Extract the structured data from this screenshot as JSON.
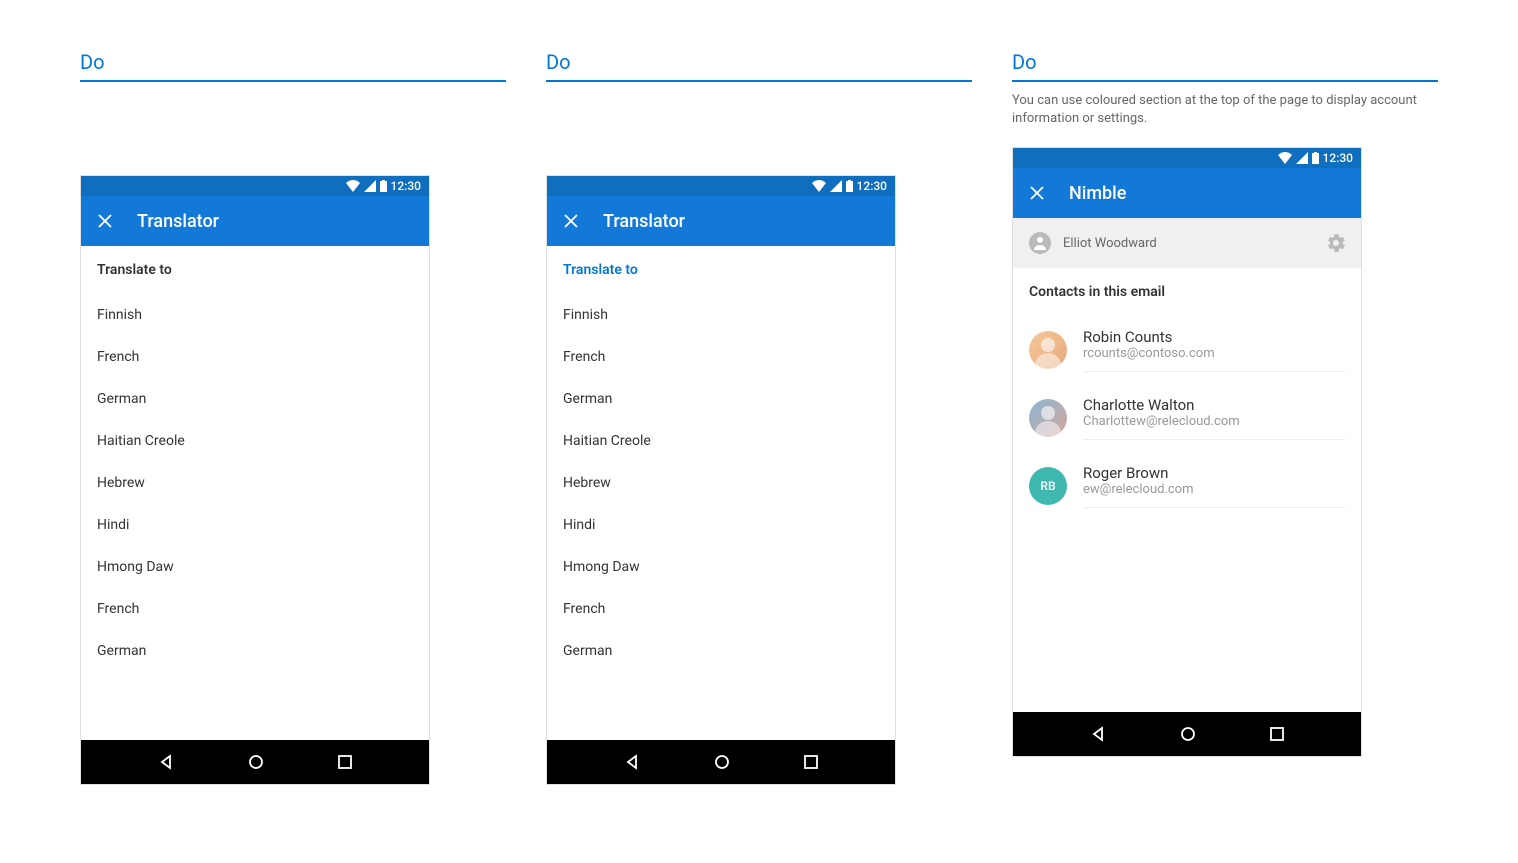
{
  "labels": {
    "do": "Do"
  },
  "status_bar": {
    "time": "12:30"
  },
  "example1": {
    "description": "",
    "app_title": "Translator",
    "section_header": "Translate to",
    "languages": [
      "Finnish",
      "French",
      "German",
      "Haitian Creole",
      "Hebrew",
      "Hindi",
      "Hmong Daw",
      "French",
      "German"
    ]
  },
  "example2": {
    "description": "",
    "app_title": "Translator",
    "section_header": "Translate to",
    "languages": [
      "Finnish",
      "French",
      "German",
      "Haitian Creole",
      "Hebrew",
      "Hindi",
      "Hmong Daw",
      "French",
      "German"
    ]
  },
  "example3": {
    "description": "You can use coloured section at the top of the page to display account information or settings.",
    "app_title": "Nimble",
    "account_name": "Elliot Woodward",
    "section_header": "Contacts in this email",
    "contacts": [
      {
        "name": "Robin Counts",
        "email": "rcounts@contoso.com",
        "avatar_type": "photo1",
        "initials": ""
      },
      {
        "name": "Charlotte Walton",
        "email": "Charlottew@relecloud.com",
        "avatar_type": "photo2",
        "initials": ""
      },
      {
        "name": "Roger Brown",
        "email": "ew@relecloud.com",
        "avatar_type": "initials",
        "initials": "RB"
      }
    ]
  }
}
